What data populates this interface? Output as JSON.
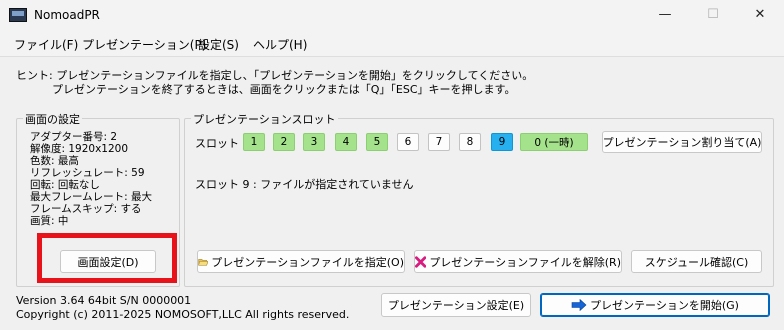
{
  "window": {
    "title": "NomoadPR",
    "minimize_symbol": "—",
    "maximize_symbol": "☐",
    "close_symbol": "✕"
  },
  "menu": [
    "ファイル(F)",
    "プレゼンテーション(P)",
    "設定(S)",
    "ヘルプ(H)"
  ],
  "hint": {
    "line1": "ヒント: プレゼンテーションファイルを指定し、「プレゼンテーションを開始」をクリックしてください。",
    "line2": "プレゼンテーションを終了するときは、画面をクリックまたは「Q」「ESC」キーを押します。"
  },
  "display": {
    "group_title": "画面の設定",
    "lines": [
      "アダプター番号: 2",
      "解像度: 1920x1200",
      "色数: 最高",
      "リフレッシュレート: 59",
      "回転: 回転なし",
      "最大フレームレート: 最大",
      "フレームスキップ: する",
      "画質: 中"
    ],
    "settings_button": "画面設定(D)"
  },
  "slots": {
    "group_title": "プレゼンテーションスロット",
    "label": "スロット",
    "items": [
      {
        "label": "1",
        "state": "filled"
      },
      {
        "label": "2",
        "state": "filled"
      },
      {
        "label": "3",
        "state": "filled"
      },
      {
        "label": "4",
        "state": "filled"
      },
      {
        "label": "5",
        "state": "filled"
      },
      {
        "label": "6",
        "state": "empty"
      },
      {
        "label": "7",
        "state": "empty"
      },
      {
        "label": "8",
        "state": "empty"
      },
      {
        "label": "9",
        "state": "selected"
      },
      {
        "label": "0 (一時)",
        "state": "filled"
      }
    ],
    "assign_button": "プレゼンテーション割り当て(A)",
    "status": "スロット 9 : ファイルが指定されていません",
    "specify_button": "プレゼンテーションファイルを指定(O)",
    "release_button": "プレゼンテーションファイルを解除(R)",
    "schedule_button": "スケジュール確認(C)"
  },
  "footer": {
    "version": "Version 3.64 64bit   S/N  0000001",
    "copyright": "Copyright (c) 2011-2025 NOMOSOFT,LLC All rights reserved.",
    "settings_button": "プレゼンテーション設定(E)",
    "start_button": "プレゼンテーションを開始(G)"
  },
  "colors": {
    "slot_filled": "#a5e28c",
    "slot_selected": "#26b0f0",
    "highlight": "#e8121a",
    "accent": "#0067c0"
  },
  "icons": {
    "folder": "folder-open-icon",
    "release": "red-x-icon",
    "start": "blue-arrow-right-icon"
  }
}
